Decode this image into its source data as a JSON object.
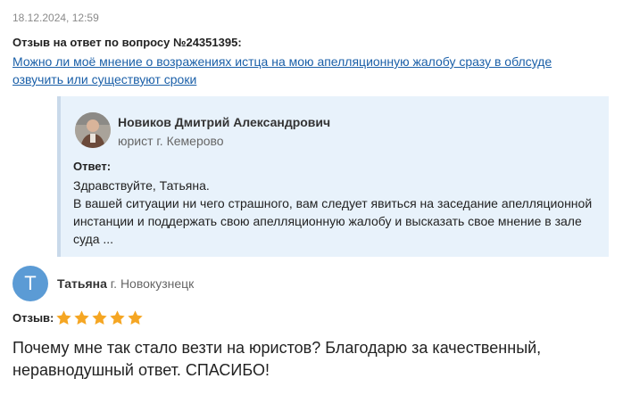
{
  "review": {
    "date": "18.12.2024, 12:59",
    "title": "Отзыв на ответ по вопросу №24351395:",
    "question_link": "Можно ли моё мнение о возражениях истца на мою апелляционную жалобу сразу в облсуде озвучить или существуют сроки"
  },
  "answer": {
    "lawyer_name": "Новиков Дмитрий Александрович",
    "lawyer_role": "юрист г. Кемерово",
    "label": "Ответ:",
    "greeting": "Здравствуйте, Татьяна.",
    "text": "В вашей ситуации ни чего страшного, вам следует явиться на заседание апелляционной инстанции и поддержать свою апелляционную жалобу и высказать свое мнение в зале суда ..."
  },
  "user": {
    "avatar_letter": "Т",
    "name": "Татьяна",
    "city": "г. Новокузнецк"
  },
  "rating": {
    "label": "Отзыв:",
    "stars": 5,
    "max_stars": 5,
    "star_color": "#f5a623"
  },
  "review_text": "Почему мне так стало везти на юристов? Благодарю за качественный, неравнодушный ответ. СПАСИБО!",
  "colors": {
    "link": "#1a5fa8",
    "answer_bg": "#e8f2fb",
    "user_avatar_bg": "#5b9bd5"
  }
}
